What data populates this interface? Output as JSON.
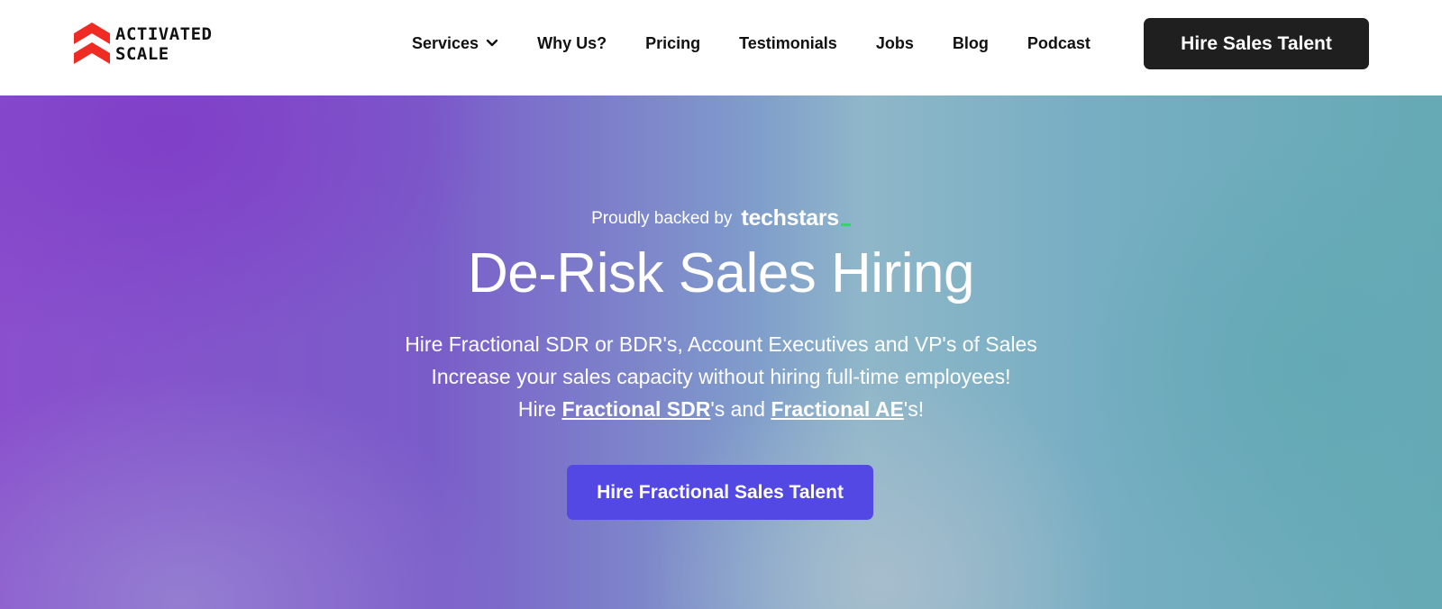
{
  "brand": {
    "name_line1": "ACTIVATED",
    "name_line2": "SCALE",
    "logo_icon": "double-chevron-up-icon",
    "logo_color": "#ef2b24"
  },
  "nav": {
    "items": [
      {
        "label": "Services",
        "has_dropdown": true
      },
      {
        "label": "Why Us?"
      },
      {
        "label": "Pricing"
      },
      {
        "label": "Testimonials"
      },
      {
        "label": "Jobs"
      },
      {
        "label": "Blog"
      },
      {
        "label": "Podcast"
      }
    ],
    "cta_label": "Hire Sales Talent",
    "cta_color": "#1f1f1f"
  },
  "hero": {
    "backed_text": "Proudly backed by",
    "backer_name": "techstars",
    "backer_accent_color": "#39d36b",
    "headline": "De-Risk Sales Hiring",
    "line1": "Hire Fractional SDR or BDR's, Account Executives and VP's of Sales",
    "line2": "Increase your sales capacity without hiring full-time employees!",
    "line3_prefix": "Hire ",
    "line3_link1": "Fractional SDR",
    "line3_mid": "'s and ",
    "line3_link2": "Fractional AE",
    "line3_suffix": "'s!",
    "cta_label": "Hire Fractional Sales Talent",
    "cta_color": "#5348e3"
  }
}
